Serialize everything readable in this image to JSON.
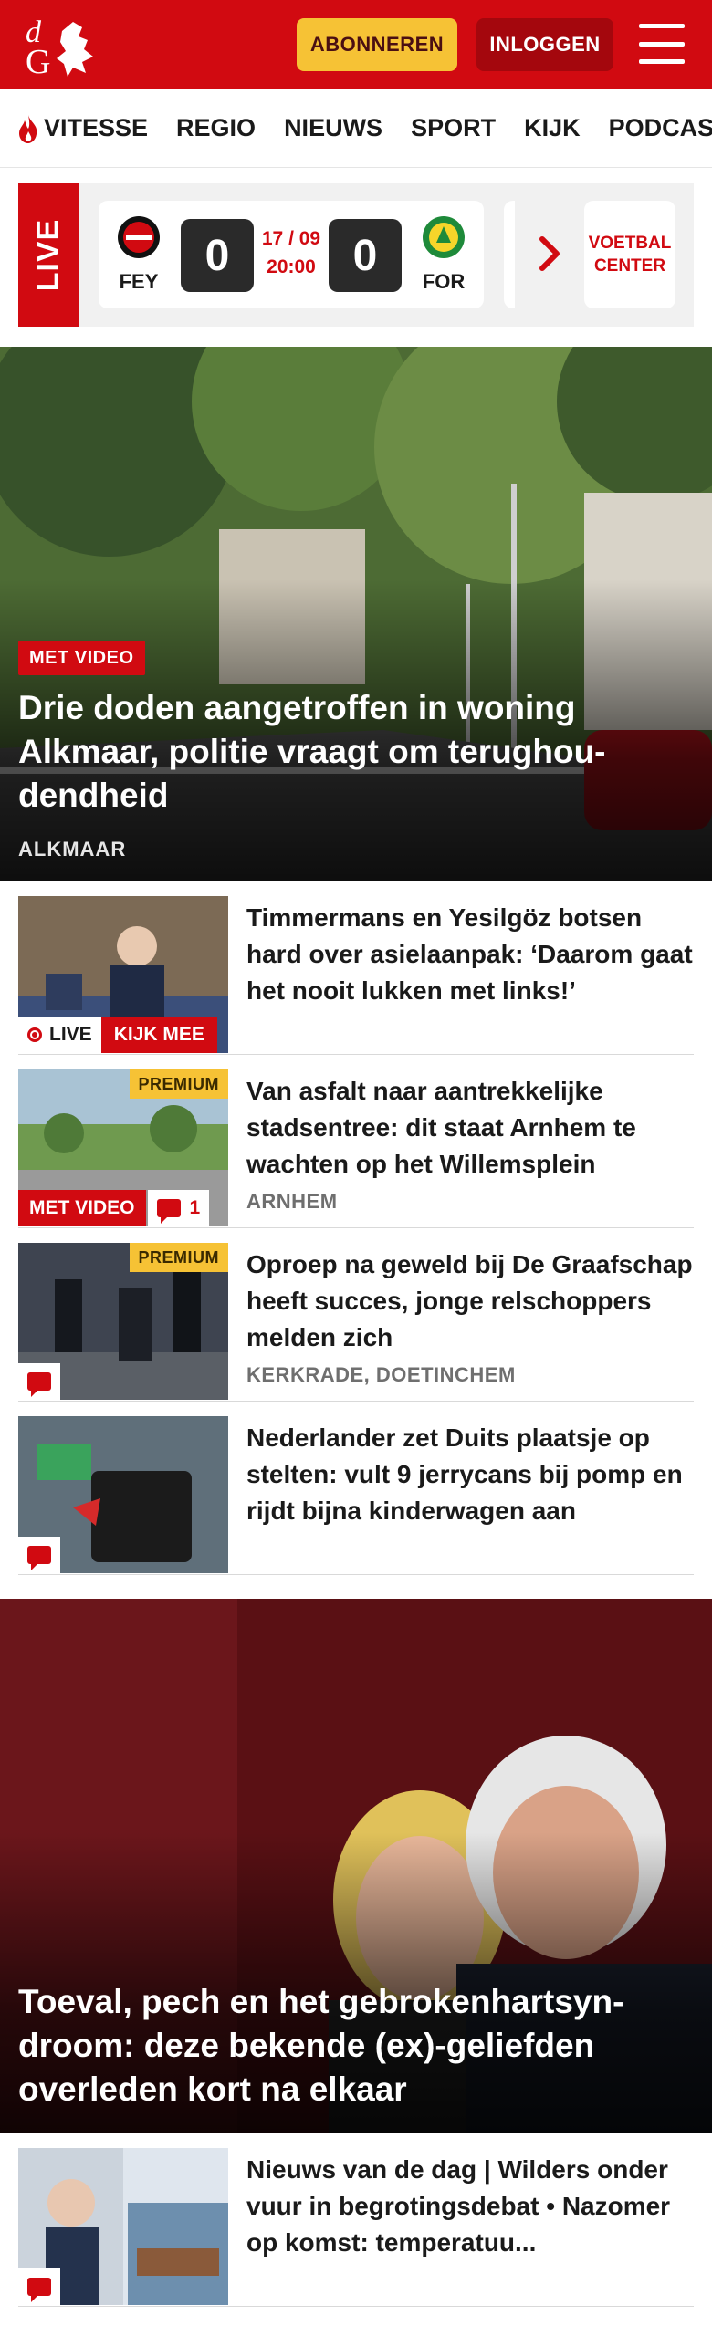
{
  "header": {
    "subscribe_label": "ABONNEREN",
    "login_label": "INLOGGEN",
    "brand_color": "#d10a11"
  },
  "nav": {
    "items": [
      "VITESSE",
      "REGIO",
      "NIEUWS",
      "SPORT",
      "KIJK",
      "PODCAST"
    ]
  },
  "live": {
    "label": "LIVE",
    "match": {
      "home": "FEY",
      "away": "FOR",
      "home_score": "0",
      "away_score": "0",
      "date": "17 / 09",
      "time": "20:00"
    },
    "voetbal_center": "VOETBAL CENTER"
  },
  "hero": {
    "badge": "MET VIDEO",
    "title": "Drie doden aangetroffen in woning Alkmaar, politie vraagt om terughou-dendheid",
    "location": "ALKMAAR"
  },
  "articles": [
    {
      "title": "Timmermans en Yesilgöz botsen hard over asielaanpak: ‘Daarom gaat het nooit lukken met links!’",
      "live_label": "LIVE",
      "watch_label": "KIJK MEE"
    },
    {
      "title": "Van asfalt naar aantrekkelijke stadsentree: dit staat Arnhem te wachten op het Willemsplein",
      "location": "ARNHEM",
      "premium": "PREMIUM",
      "video_label": "MET VIDEO",
      "comments": "1"
    },
    {
      "title": "Oproep na geweld bij De Graafschap heeft succes, jonge relschoppers melden zich",
      "location": "KERKRADE, DOETINCHEM",
      "premium": "PREMIUM"
    },
    {
      "title": "Nederlander zet Duits plaatsje op stelten: vult 9 jerrycans bij pomp en rijdt bijna kinderwagen aan"
    }
  ],
  "feature": {
    "title": "Toeval, pech en het gebrokenhartsyn-droom: deze bekende (ex)-geliefden overleden kort na elkaar"
  },
  "articles_after": [
    {
      "title": "Nieuws van de dag | Wilders onder vuur in begrotingsdebat • Nazomer op komst: temperatuu..."
    }
  ]
}
